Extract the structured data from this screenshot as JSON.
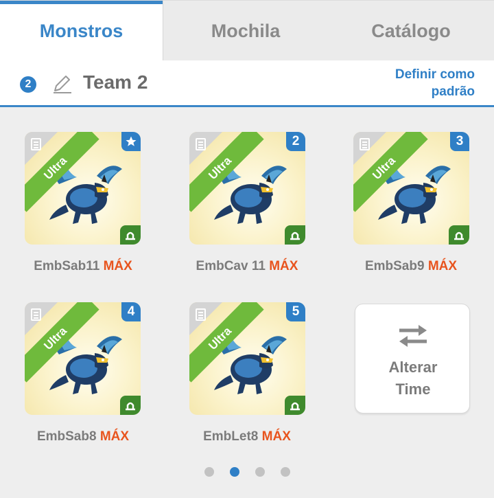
{
  "tabs": [
    {
      "label": "Monstros",
      "active": true
    },
    {
      "label": "Mochila",
      "active": false
    },
    {
      "label": "Catálogo",
      "active": false
    }
  ],
  "team": {
    "number": "2",
    "name": "Team 2",
    "default_line1": "Definir como",
    "default_line2": "padrão"
  },
  "monsters": [
    {
      "name": "EmbSab11",
      "max": "MÁX",
      "rarity": "Ultra",
      "slot": "star-icon"
    },
    {
      "name": "EmbCav 11",
      "max": "MÁX",
      "rarity": "Ultra",
      "slot": "2"
    },
    {
      "name": "EmbSab9",
      "max": "MÁX",
      "rarity": "Ultra",
      "slot": "3"
    },
    {
      "name": "EmbSab8",
      "max": "MÁX",
      "rarity": "Ultra",
      "slot": "4"
    },
    {
      "name": "EmbLet8",
      "max": "MÁX",
      "rarity": "Ultra",
      "slot": "5"
    }
  ],
  "swap": {
    "line1": "Alterar",
    "line2": "Time",
    "icon": "swap-arrows-icon"
  },
  "pagination": {
    "pages": 4,
    "current": 2
  },
  "colors": {
    "accent": "#2f7fc6",
    "ultra": "#6fba3c",
    "max": "#e8541e",
    "element": "#3f8a2d"
  }
}
